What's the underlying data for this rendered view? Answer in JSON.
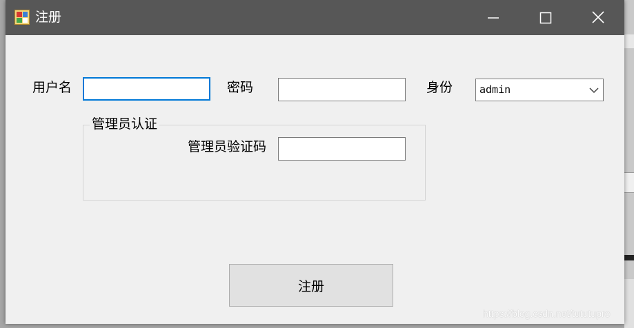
{
  "window": {
    "title": "注册",
    "icon": "app-form-icon",
    "controls": {
      "minimize": "minimize-icon",
      "maximize": "maximize-icon",
      "close": "close-icon"
    }
  },
  "form": {
    "username_label": "用户名",
    "username_value": "",
    "password_label": "密码",
    "password_value": "",
    "role_label": "身份",
    "role_selected": "admin",
    "admin_group": {
      "legend": "管理员认证",
      "code_label": "管理员验证码",
      "code_value": ""
    },
    "submit_label": "注册"
  },
  "watermark": "https://blog.csdn.net/tututupro",
  "colors": {
    "titlebar": "#575757",
    "window_bg": "#f0f0f0",
    "focus_border": "#0078d7",
    "button_bg": "#e1e1e1"
  }
}
